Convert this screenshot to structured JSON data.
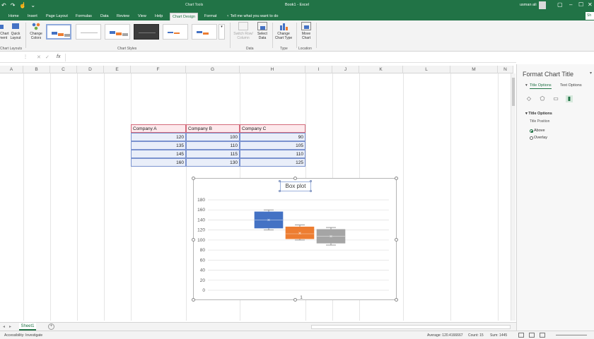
{
  "titlebar": {
    "context_tab": "Chart Tools",
    "document_title": "Book1 - Excel",
    "user_name": "usman ali"
  },
  "ribbon_tabs": [
    {
      "label": "Home"
    },
    {
      "label": "Insert"
    },
    {
      "label": "Page Layout"
    },
    {
      "label": "Formulas"
    },
    {
      "label": "Data"
    },
    {
      "label": "Review"
    },
    {
      "label": "View"
    },
    {
      "label": "Help"
    },
    {
      "label": "Chart Design",
      "active": true
    },
    {
      "label": "Format"
    }
  ],
  "tell_me": "Tell me what you want to do",
  "share": "Sh",
  "ribbon": {
    "add_element": "Add Chart\nElement",
    "quick_layout": "Quick\nLayout",
    "change_colors": "Change\nColors",
    "switch_row_col": "Switch Row/\nColumn",
    "select_data": "Select\nData",
    "change_chart_type": "Change\nChart Type",
    "move_chart": "Move\nChart",
    "groups": {
      "chart_layouts": "Chart Layouts",
      "chart_styles": "Chart Styles",
      "data": "Data",
      "type": "Type",
      "location": "Location"
    }
  },
  "formula_bar": {
    "fx": "fx",
    "cancel": "✕",
    "enter": "✓"
  },
  "columns": [
    "A",
    "B",
    "C",
    "D",
    "E",
    "F",
    "G",
    "H",
    "I",
    "J",
    "K",
    "L",
    "M",
    "N"
  ],
  "table": {
    "headers": [
      "Company A",
      "Company B",
      "Company C"
    ],
    "rows": [
      [
        "120",
        "100",
        "90"
      ],
      [
        "135",
        "110",
        "105"
      ],
      [
        "145",
        "115",
        "110"
      ],
      [
        "160",
        "130",
        "125"
      ]
    ]
  },
  "chart_data": {
    "type": "box",
    "title": "Box plot",
    "categories": [
      "1"
    ],
    "ylim": [
      0,
      180
    ],
    "yticks": [
      "0",
      "20",
      "40",
      "60",
      "80",
      "100",
      "120",
      "140",
      "160",
      "180"
    ],
    "grid": true,
    "series": [
      {
        "name": "Company A",
        "color": "#4472c4",
        "min": 120,
        "q1": 123.75,
        "median": 140,
        "q3": 156.25,
        "max": 160,
        "mean": 140
      },
      {
        "name": "Company B",
        "color": "#ed7d31",
        "min": 100,
        "q1": 102.5,
        "median": 112.5,
        "q3": 126.25,
        "max": 130,
        "mean": 113.75
      },
      {
        "name": "Company C",
        "color": "#a5a5a5",
        "min": 90,
        "q1": 93.75,
        "median": 107.5,
        "q3": 121.25,
        "max": 125,
        "mean": 107.5
      }
    ]
  },
  "sheet_tab": "Sheet1",
  "status": {
    "accessibility": "Accessibility: Investigate",
    "average": "Average: 120.4166667",
    "count": "Count: 15",
    "sum": "Sum: 1445"
  },
  "pane": {
    "title": "Format Chart Title",
    "tab_title_options": "Title Options",
    "tab_text_options": "Text Options",
    "section": "Title Options",
    "sublabel": "Title Position",
    "radio_above": "Above",
    "radio_overlay": "Overlay"
  }
}
